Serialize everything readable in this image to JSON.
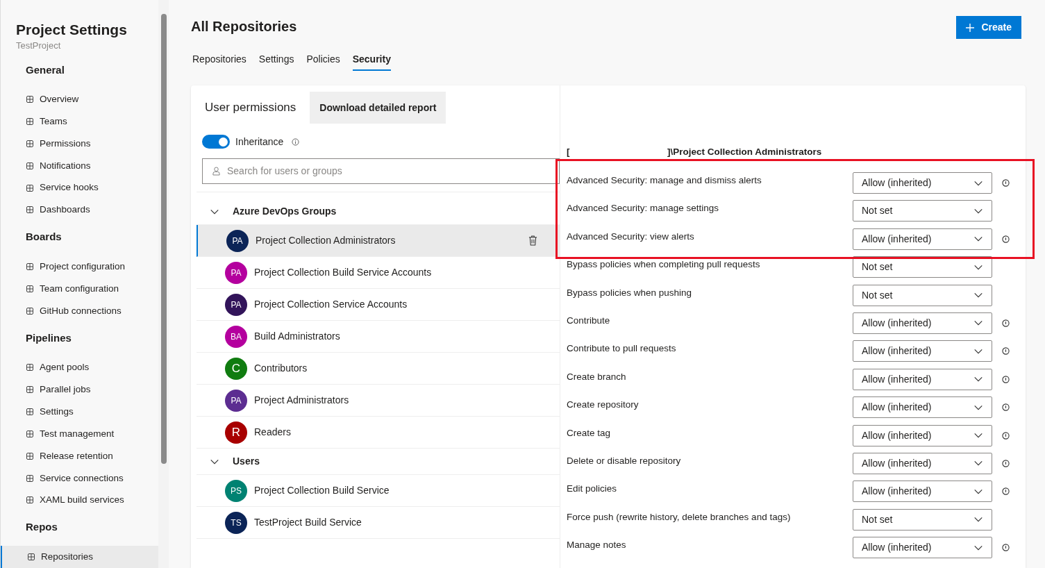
{
  "sidebar": {
    "title": "Project Settings",
    "subtitle": "TestProject",
    "sections": [
      {
        "heading": "General",
        "items": [
          {
            "label": "Overview",
            "selected": false
          },
          {
            "label": "Teams",
            "selected": false
          },
          {
            "label": "Permissions",
            "selected": false
          },
          {
            "label": "Notifications",
            "selected": false
          },
          {
            "label": "Service hooks",
            "selected": false
          },
          {
            "label": "Dashboards",
            "selected": false
          }
        ]
      },
      {
        "heading": "Boards",
        "items": [
          {
            "label": "Project configuration",
            "selected": false
          },
          {
            "label": "Team configuration",
            "selected": false
          },
          {
            "label": "GitHub connections",
            "selected": false
          }
        ]
      },
      {
        "heading": "Pipelines",
        "items": [
          {
            "label": "Agent pools",
            "selected": false
          },
          {
            "label": "Parallel jobs",
            "selected": false
          },
          {
            "label": "Settings",
            "selected": false
          },
          {
            "label": "Test management",
            "selected": false
          },
          {
            "label": "Release retention",
            "selected": false
          },
          {
            "label": "Service connections",
            "selected": false
          },
          {
            "label": "XAML build services",
            "selected": false
          }
        ]
      },
      {
        "heading": "Repos",
        "items": [
          {
            "label": "Repositories",
            "selected": true
          }
        ]
      }
    ]
  },
  "page": {
    "title": "All Repositories",
    "create_button": "Create",
    "tabs": [
      {
        "label": "Repositories",
        "selected": false
      },
      {
        "label": "Settings",
        "selected": false
      },
      {
        "label": "Policies",
        "selected": false
      },
      {
        "label": "Security",
        "selected": true
      }
    ]
  },
  "permissions_panel": {
    "title": "User permissions",
    "download_button": "Download detailed report",
    "inheritance": {
      "label": "Inheritance",
      "on": true
    },
    "search": {
      "placeholder": "Search for users or groups"
    },
    "groups": [
      {
        "heading": "Azure DevOps Groups",
        "expanded": true,
        "members": [
          {
            "initials": "PA",
            "name": "Project Collection Administrators",
            "color": "#0b2457",
            "selected": true
          },
          {
            "initials": "PA",
            "name": "Project Collection Build Service Accounts",
            "color": "#b4009e",
            "selected": false
          },
          {
            "initials": "PA",
            "name": "Project Collection Service Accounts",
            "color": "#32145a",
            "selected": false
          },
          {
            "initials": "BA",
            "name": "Build Administrators",
            "color": "#b4009e",
            "selected": false
          },
          {
            "initials": "C",
            "name": "Contributors",
            "color": "#107c10",
            "selected": false
          },
          {
            "initials": "PA",
            "name": "Project Administrators",
            "color": "#5c2d91",
            "selected": false
          },
          {
            "initials": "R",
            "name": "Readers",
            "color": "#a80000",
            "selected": false
          }
        ]
      },
      {
        "heading": "Users",
        "expanded": true,
        "members": [
          {
            "initials": "PS",
            "name": "Project Collection Build Service",
            "color": "#008272",
            "selected": false
          },
          {
            "initials": "TS",
            "name": "TestProject Build Service",
            "color": "#0b2457",
            "selected": false
          }
        ]
      }
    ]
  },
  "detail": {
    "identity_prefix": "[",
    "identity_name": "]\\Project Collection Administrators",
    "permissions": [
      {
        "name": "Advanced Security: manage and dismiss alerts",
        "value": "Allow (inherited)",
        "info": true
      },
      {
        "name": "Advanced Security: manage settings",
        "value": "Not set",
        "info": false
      },
      {
        "name": "Advanced Security: view alerts",
        "value": "Allow (inherited)",
        "info": true
      },
      {
        "name": "Bypass policies when completing pull requests",
        "value": "Not set",
        "info": false
      },
      {
        "name": "Bypass policies when pushing",
        "value": "Not set",
        "info": false
      },
      {
        "name": "Contribute",
        "value": "Allow (inherited)",
        "info": true
      },
      {
        "name": "Contribute to pull requests",
        "value": "Allow (inherited)",
        "info": true
      },
      {
        "name": "Create branch",
        "value": "Allow (inherited)",
        "info": true
      },
      {
        "name": "Create repository",
        "value": "Allow (inherited)",
        "info": true
      },
      {
        "name": "Create tag",
        "value": "Allow (inherited)",
        "info": true
      },
      {
        "name": "Delete or disable repository",
        "value": "Allow (inherited)",
        "info": true
      },
      {
        "name": "Edit policies",
        "value": "Allow (inherited)",
        "info": true
      },
      {
        "name": "Force push (rewrite history, delete branches and tags)",
        "value": "Not set",
        "info": false
      },
      {
        "name": "Manage notes",
        "value": "Allow (inherited)",
        "info": true
      }
    ]
  }
}
